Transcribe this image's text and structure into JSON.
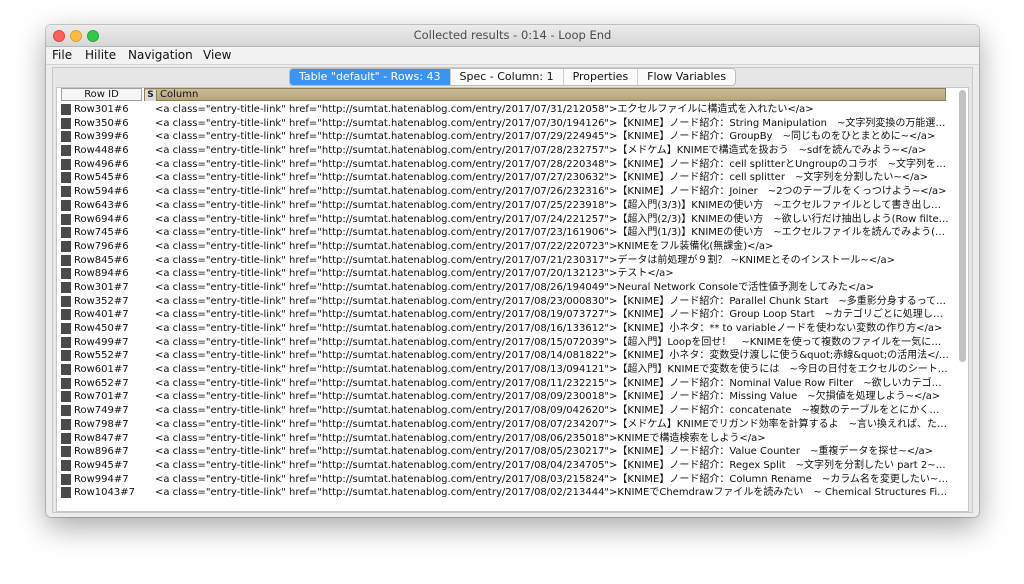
{
  "window": {
    "title": "Collected results - 0:14 - Loop End"
  },
  "menu": [
    "File",
    "Hilite",
    "Navigation",
    "View"
  ],
  "tabs": [
    {
      "label": "Table \"default\" - Rows: 43",
      "active": true
    },
    {
      "label": "Spec - Column: 1",
      "active": false
    },
    {
      "label": "Properties",
      "active": false
    },
    {
      "label": "Flow Variables",
      "active": false
    }
  ],
  "table": {
    "headers": {
      "row_id": "Row ID",
      "column_type": "S",
      "column": "Column"
    },
    "rows": [
      {
        "id": "Row301#6",
        "value": "<a class=\"entry-title-link\" href=\"http://sumtat.hatenablog.com/entry/2017/07/31/212058\">エクセルファイルに構造式を入れたい</a>"
      },
      {
        "id": "Row350#6",
        "value": "<a class=\"entry-title-link\" href=\"http://sumtat.hatenablog.com/entry/2017/07/30/194126\">【KNIME】ノード紹介：String Manipulation　~文字列変換の万能選手~</a>"
      },
      {
        "id": "Row399#6",
        "value": "<a class=\"entry-title-link\" href=\"http://sumtat.hatenablog.com/entry/2017/07/29/224945\">【KNIME】ノード紹介：GroupBy　~同じものをひとまとめに~</a>"
      },
      {
        "id": "Row448#6",
        "value": "<a class=\"entry-title-link\" href=\"http://sumtat.hatenablog.com/entry/2017/07/28/232757\">【メドケム】KNIMEで構造式を扱おう　~sdfを読んでみよう~</a>"
      },
      {
        "id": "Row496#6",
        "value": "<a class=\"entry-title-link\" href=\"http://sumtat.hatenablog.com/entry/2017/07/28/220348\">【KNIME】ノード紹介：cell splitterとUngroupのコラボ　~文字列を縦方向..."
      },
      {
        "id": "Row545#6",
        "value": "<a class=\"entry-title-link\" href=\"http://sumtat.hatenablog.com/entry/2017/07/27/230632\">【KNIME】ノード紹介：cell splitter　~文字列を分割したい~</a>"
      },
      {
        "id": "Row594#6",
        "value": "<a class=\"entry-title-link\" href=\"http://sumtat.hatenablog.com/entry/2017/07/26/232316\">【KNIME】ノード紹介：Joiner　~2つのテーブルをくっつけよう~</a>"
      },
      {
        "id": "Row643#6",
        "value": "<a class=\"entry-title-link\" href=\"http://sumtat.hatenablog.com/entry/2017/07/25/223918\">【超入門(3/3)】KNIMEの使い方　~エクセルファイルとして書き出してみよ..."
      },
      {
        "id": "Row694#6",
        "value": "<a class=\"entry-title-link\" href=\"http://sumtat.hatenablog.com/entry/2017/07/24/221257\">【超入門(2/3)】KNIMEの使い方　~欲しい行だけ抽出しよう(Row filter, spli..."
      },
      {
        "id": "Row745#6",
        "value": "<a class=\"entry-title-link\" href=\"http://sumtat.hatenablog.com/entry/2017/07/23/161906\">【超入門(1/3)】KNIMEの使い方　~エクセルファイルを読んでみよう(Excel ..."
      },
      {
        "id": "Row796#6",
        "value": "<a class=\"entry-title-link\" href=\"http://sumtat.hatenablog.com/entry/2017/07/22/220723\">KNIMEをフル装備化(無課金)</a>"
      },
      {
        "id": "Row845#6",
        "value": "<a class=\"entry-title-link\" href=\"http://sumtat.hatenablog.com/entry/2017/07/21/230317\">データは前処理が９割？ ~KNIMEとそのインストール~</a>"
      },
      {
        "id": "Row894#6",
        "value": "<a class=\"entry-title-link\" href=\"http://sumtat.hatenablog.com/entry/2017/07/20/132123\">テスト</a>"
      },
      {
        "id": "Row301#7",
        "value": "<a class=\"entry-title-link\" href=\"http://sumtat.hatenablog.com/entry/2017/08/26/194049\">Neural Network Consoleで活性値予測をしてみた</a>"
      },
      {
        "id": "Row352#7",
        "value": "<a class=\"entry-title-link\" href=\"http://sumtat.hatenablog.com/entry/2017/08/23/000830\">【KNIME】ノード紹介：Parallel Chunk Start　~多重影分身するってばよ~..."
      },
      {
        "id": "Row401#7",
        "value": "<a class=\"entry-title-link\" href=\"http://sumtat.hatenablog.com/entry/2017/08/19/073727\">【KNIME】ノード紹介：Group Loop Start　~カテゴリごとに処理したい~..."
      },
      {
        "id": "Row450#7",
        "value": "<a class=\"entry-title-link\" href=\"http://sumtat.hatenablog.com/entry/2017/08/16/133612\">【KNIME】小ネタ：** to variableノードを使わない変数の作り方</a>"
      },
      {
        "id": "Row499#7",
        "value": "<a class=\"entry-title-link\" href=\"http://sumtat.hatenablog.com/entry/2017/08/15/072039\">【超入門】Loopを回せ！　~KNIMEを使って複数のファイルを一気に読んで..."
      },
      {
        "id": "Row552#7",
        "value": "<a class=\"entry-title-link\" href=\"http://sumtat.hatenablog.com/entry/2017/08/14/081822\">【KNIME】小ネタ：変数受け渡しに使う&quot;赤線&quot;の活用法</a>"
      },
      {
        "id": "Row601#7",
        "value": "<a class=\"entry-title-link\" href=\"http://sumtat.hatenablog.com/entry/2017/08/13/094121\">【超入門】KNIMEで変数を使うには　~今日の日付をエクセルのシート名に..."
      },
      {
        "id": "Row652#7",
        "value": "<a class=\"entry-title-link\" href=\"http://sumtat.hatenablog.com/entry/2017/08/11/232215\">【KNIME】ノード紹介：Nominal Value Row Filter　~欲しいカテゴリのrow..."
      },
      {
        "id": "Row701#7",
        "value": "<a class=\"entry-title-link\" href=\"http://sumtat.hatenablog.com/entry/2017/08/09/230018\">【KNIME】ノード紹介：Missing Value　~欠損値を処理しよう~</a>"
      },
      {
        "id": "Row749#7",
        "value": "<a class=\"entry-title-link\" href=\"http://sumtat.hatenablog.com/entry/2017/08/09/042620\">【KNIME】ノード紹介：concatenate　~複数のテーブルをとにかく纏める~..."
      },
      {
        "id": "Row798#7",
        "value": "<a class=\"entry-title-link\" href=\"http://sumtat.hatenablog.com/entry/2017/08/07/234207\">【メドケム】KNIMEでリガンド効率を計算するよ　~言い換えれば、ただの..."
      },
      {
        "id": "Row847#7",
        "value": "<a class=\"entry-title-link\" href=\"http://sumtat.hatenablog.com/entry/2017/08/06/235018\">KNIMEで構造検索をしよう</a>"
      },
      {
        "id": "Row896#7",
        "value": "<a class=\"entry-title-link\" href=\"http://sumtat.hatenablog.com/entry/2017/08/05/230217\">【KNIME】ノード紹介：Value Counter　~重複データを探せ~</a>"
      },
      {
        "id": "Row945#7",
        "value": "<a class=\"entry-title-link\" href=\"http://sumtat.hatenablog.com/entry/2017/08/04/234705\">【KNIME】ノード紹介：Regex Split　~文字列を分割したい part 2~</a>"
      },
      {
        "id": "Row994#7",
        "value": "<a class=\"entry-title-link\" href=\"http://sumtat.hatenablog.com/entry/2017/08/03/215824\">【KNIME】ノード紹介：Column Rename　~カラム名を変更したい~</a>"
      },
      {
        "id": "Row1043#7",
        "value": "<a class=\"entry-title-link\" href=\"http://sumtat.hatenablog.com/entry/2017/08/02/213444\">KNIMEでChemdrawファイルを読みたい　~ Chemical Structures File Read..."
      }
    ]
  }
}
